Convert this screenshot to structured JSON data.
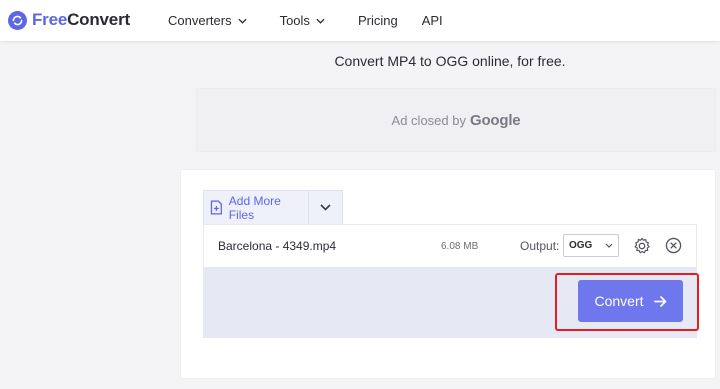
{
  "brand": {
    "free": "Free",
    "convert": "Convert",
    "accent": "#5e66e6"
  },
  "nav": {
    "converters": "Converters",
    "tools": "Tools",
    "pricing": "Pricing",
    "api": "API"
  },
  "tagline": "Convert MP4 to OGG online, for free.",
  "ad": {
    "text": "Ad closed by",
    "brand": "Google"
  },
  "uploader": {
    "add_files_label": "Add More Files",
    "file": {
      "name": "Barcelona - 4349.mp4",
      "size": "6.08 MB",
      "output_label": "Output:",
      "format": "OGG"
    },
    "convert_label": "Convert",
    "button_color": "#6e77ec",
    "highlight_color": "#e51c23"
  },
  "icons": {
    "logo": "refresh-logo-icon",
    "nav_chevron": "chevron-down-icon",
    "add_file": "file-plus-icon",
    "settings": "gear-icon",
    "remove": "close-circle-icon",
    "convert_arrow": "arrow-right-icon"
  }
}
